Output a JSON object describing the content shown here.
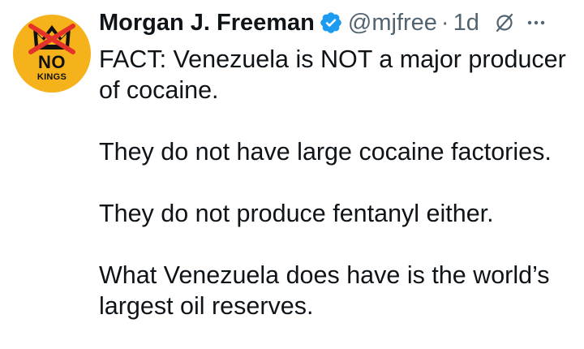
{
  "avatar": {
    "no_text": "NO",
    "kings_text": "KINGS",
    "background": "#f6b21a"
  },
  "author": {
    "display_name": "Morgan J. Freeman",
    "verified_icon": "verified-badge-icon",
    "verified_color": "#1d9bf0",
    "handle": "@mjfree",
    "separator": "·",
    "timestamp": "1d"
  },
  "icons": {
    "grok": "grok-icon",
    "more": "more-options-icon"
  },
  "tweet": {
    "paragraphs": [
      "FACT: Venezuela is NOT a major producer of cocaine.",
      "They do not have large cocaine factories.",
      "They do not produce fentanyl either.",
      "What Venezuela does have is the world’s largest oil reserves."
    ]
  }
}
